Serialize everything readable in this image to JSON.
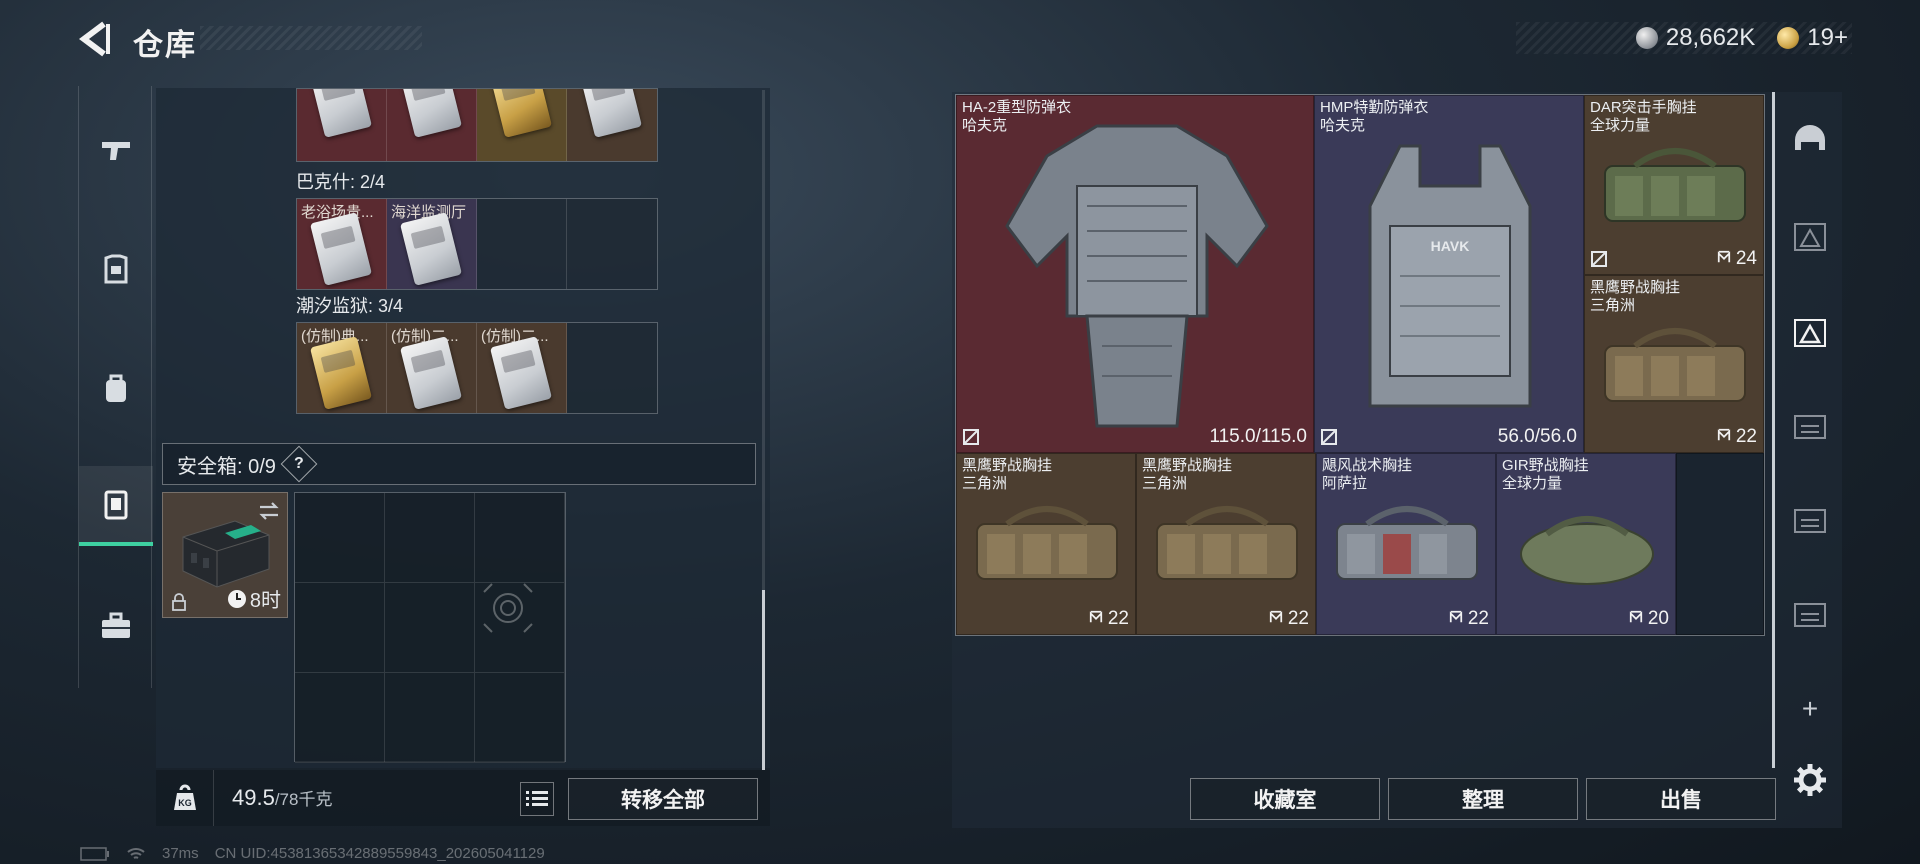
{
  "header": {
    "title": "仓库",
    "currency_primary": "28,662K",
    "currency_secondary": "19+"
  },
  "rail": {
    "items": [
      {
        "icon": "gun-icon"
      },
      {
        "icon": "armor-icon"
      },
      {
        "icon": "backpack-icon"
      },
      {
        "icon": "safebox-icon",
        "active": true
      },
      {
        "icon": "toolbox-icon"
      }
    ]
  },
  "stash": {
    "sections": [
      {
        "label": "",
        "cells": [
          {
            "color": "red"
          },
          {
            "color": "red"
          },
          {
            "color": "gold"
          },
          {
            "color": "brown"
          }
        ]
      },
      {
        "label": "巴克什: 2/4",
        "cells": [
          {
            "color": "red",
            "text": "老浴场贵..."
          },
          {
            "color": "purple",
            "text": "海洋监测厅"
          },
          {
            "color": "empty"
          },
          {
            "color": "empty"
          }
        ]
      },
      {
        "label": "潮汐监狱: 3/4",
        "cells": [
          {
            "color": "brown",
            "text": "(仿制)典..."
          },
          {
            "color": "brown",
            "text": "(仿制)二..."
          },
          {
            "color": "brown",
            "text": "(仿制)二..."
          },
          {
            "color": "empty"
          }
        ]
      }
    ],
    "safebox_label": "安全箱: 0/9",
    "help": "?",
    "safebox_timer": "8时",
    "weight_current": "49.5",
    "weight_max": "/78千克",
    "transfer_all": "转移全部"
  },
  "status": {
    "ping": "37ms",
    "uid": "CN UID:4538136534288955984​3_202605041129"
  },
  "inventory": {
    "items": [
      {
        "name1": "HA-2重型防弹衣",
        "name2": "哈夫克",
        "stat": "115.0/115.0",
        "color": "red",
        "kind": "armor-heavy"
      },
      {
        "name1": "HMP特勤防弹衣",
        "name2": "哈夫克",
        "stat": "56.0/56.0",
        "color": "purple",
        "kind": "armor-plate"
      },
      {
        "name1": "DAR突击手胸挂",
        "name2": "全球力量",
        "stat": "24",
        "color": "brown",
        "kind": "rig-green"
      },
      {
        "name1": "黑鹰野战胸挂",
        "name2": "三角洲",
        "stat": "22",
        "color": "brown",
        "kind": "rig-tan"
      },
      {
        "name1": "黑鹰野战胸挂",
        "name2": "三角洲",
        "stat": "22",
        "color": "brown",
        "kind": "rig-tan"
      },
      {
        "name1": "黑鹰野战胸挂",
        "name2": "三角洲",
        "stat": "22",
        "color": "brown",
        "kind": "rig-tan"
      },
      {
        "name1": "飓风战术胸挂",
        "name2": "阿萨拉",
        "stat": "22",
        "color": "purple",
        "kind": "rig-camo"
      },
      {
        "name1": "GIR野战胸挂",
        "name2": "全球力量",
        "stat": "20",
        "color": "purple",
        "kind": "rig-olive"
      }
    ],
    "buttons": {
      "collection": "收藏室",
      "sort": "整理",
      "sell": "出售"
    }
  },
  "tools": {
    "add": "+"
  },
  "colors": {
    "accent": "#3ed0a1",
    "rarity_red": "#5a2a32",
    "rarity_purple": "#3a3a58",
    "rarity_brown": "#4c3e30"
  }
}
